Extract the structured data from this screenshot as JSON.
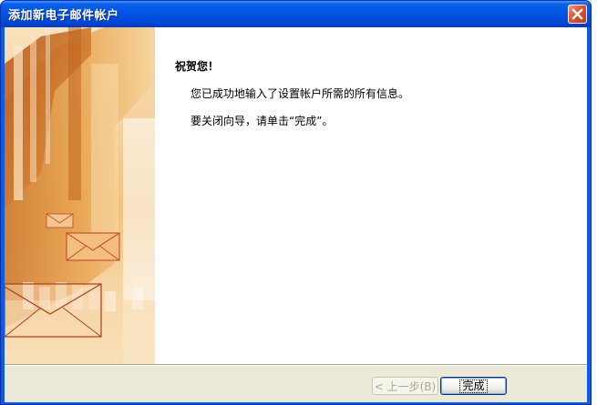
{
  "window": {
    "title": "添加新电子邮件帐户"
  },
  "wizard": {
    "heading": "祝贺您！",
    "message_line1": "您已成功地输入了设置帐户所需的所有信息。",
    "message_line2": "要关闭向导，请单击“完成”。"
  },
  "buttons": {
    "back_label": "< 上一步(B)",
    "finish_label": "完成"
  },
  "icons": {
    "close": "close-icon",
    "envelope": "envelope-icon",
    "back_arrow": "chevron-left-icon"
  },
  "colors": {
    "titlebar": "#0055e5",
    "close_button": "#e0502a",
    "dialog_face": "#ece9d8",
    "art_accent": "#e8a040"
  }
}
